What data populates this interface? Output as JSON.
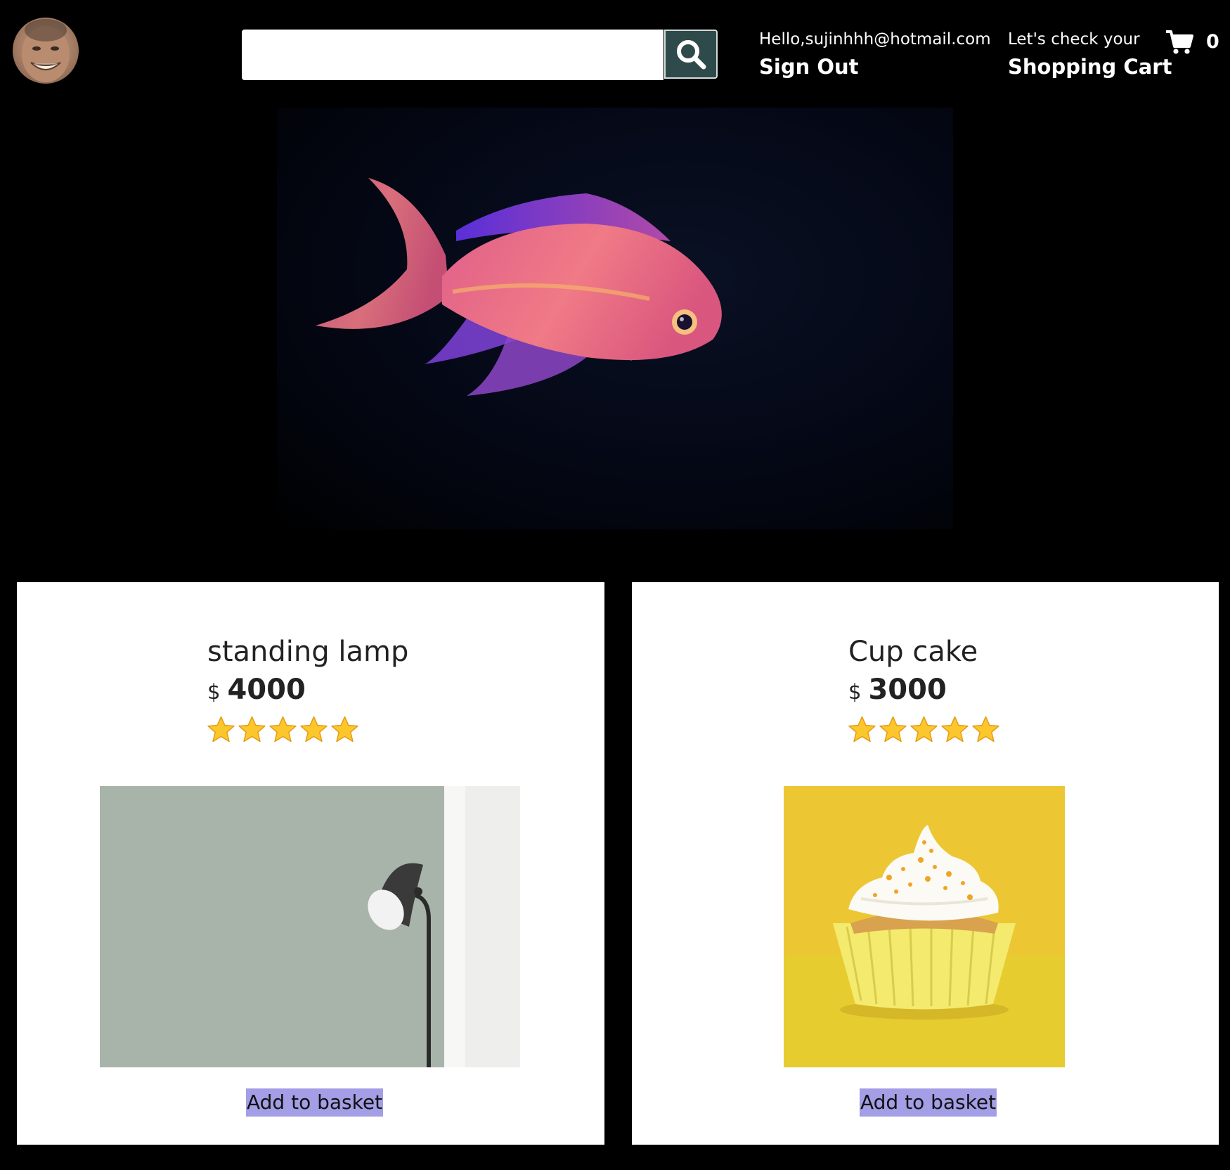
{
  "header": {
    "search": {
      "value": "",
      "placeholder": ""
    },
    "user_option": {
      "line_one": "Hello,sujinhhh@hotmail.com",
      "line_two": "Sign Out"
    },
    "cart_option": {
      "line_one": "Let's check your",
      "line_two": "Shopping Cart"
    },
    "cart_count": "0"
  },
  "products": [
    {
      "title": "standing lamp",
      "currency": "$",
      "price": "4000",
      "rating": 5,
      "button_label": "Add to basket"
    },
    {
      "title": "Cup cake",
      "currency": "$",
      "price": "3000",
      "rating": 5,
      "button_label": "Add to basket"
    }
  ],
  "colors": {
    "page_background": "#000000",
    "search_button": "#2f4a4a",
    "add_button": "#a49ee6",
    "card_background": "#ffffff",
    "text_dark": "#222222"
  },
  "icons": {
    "search": "search-icon",
    "cart": "shopping-cart-icon",
    "star": "star-icon"
  }
}
